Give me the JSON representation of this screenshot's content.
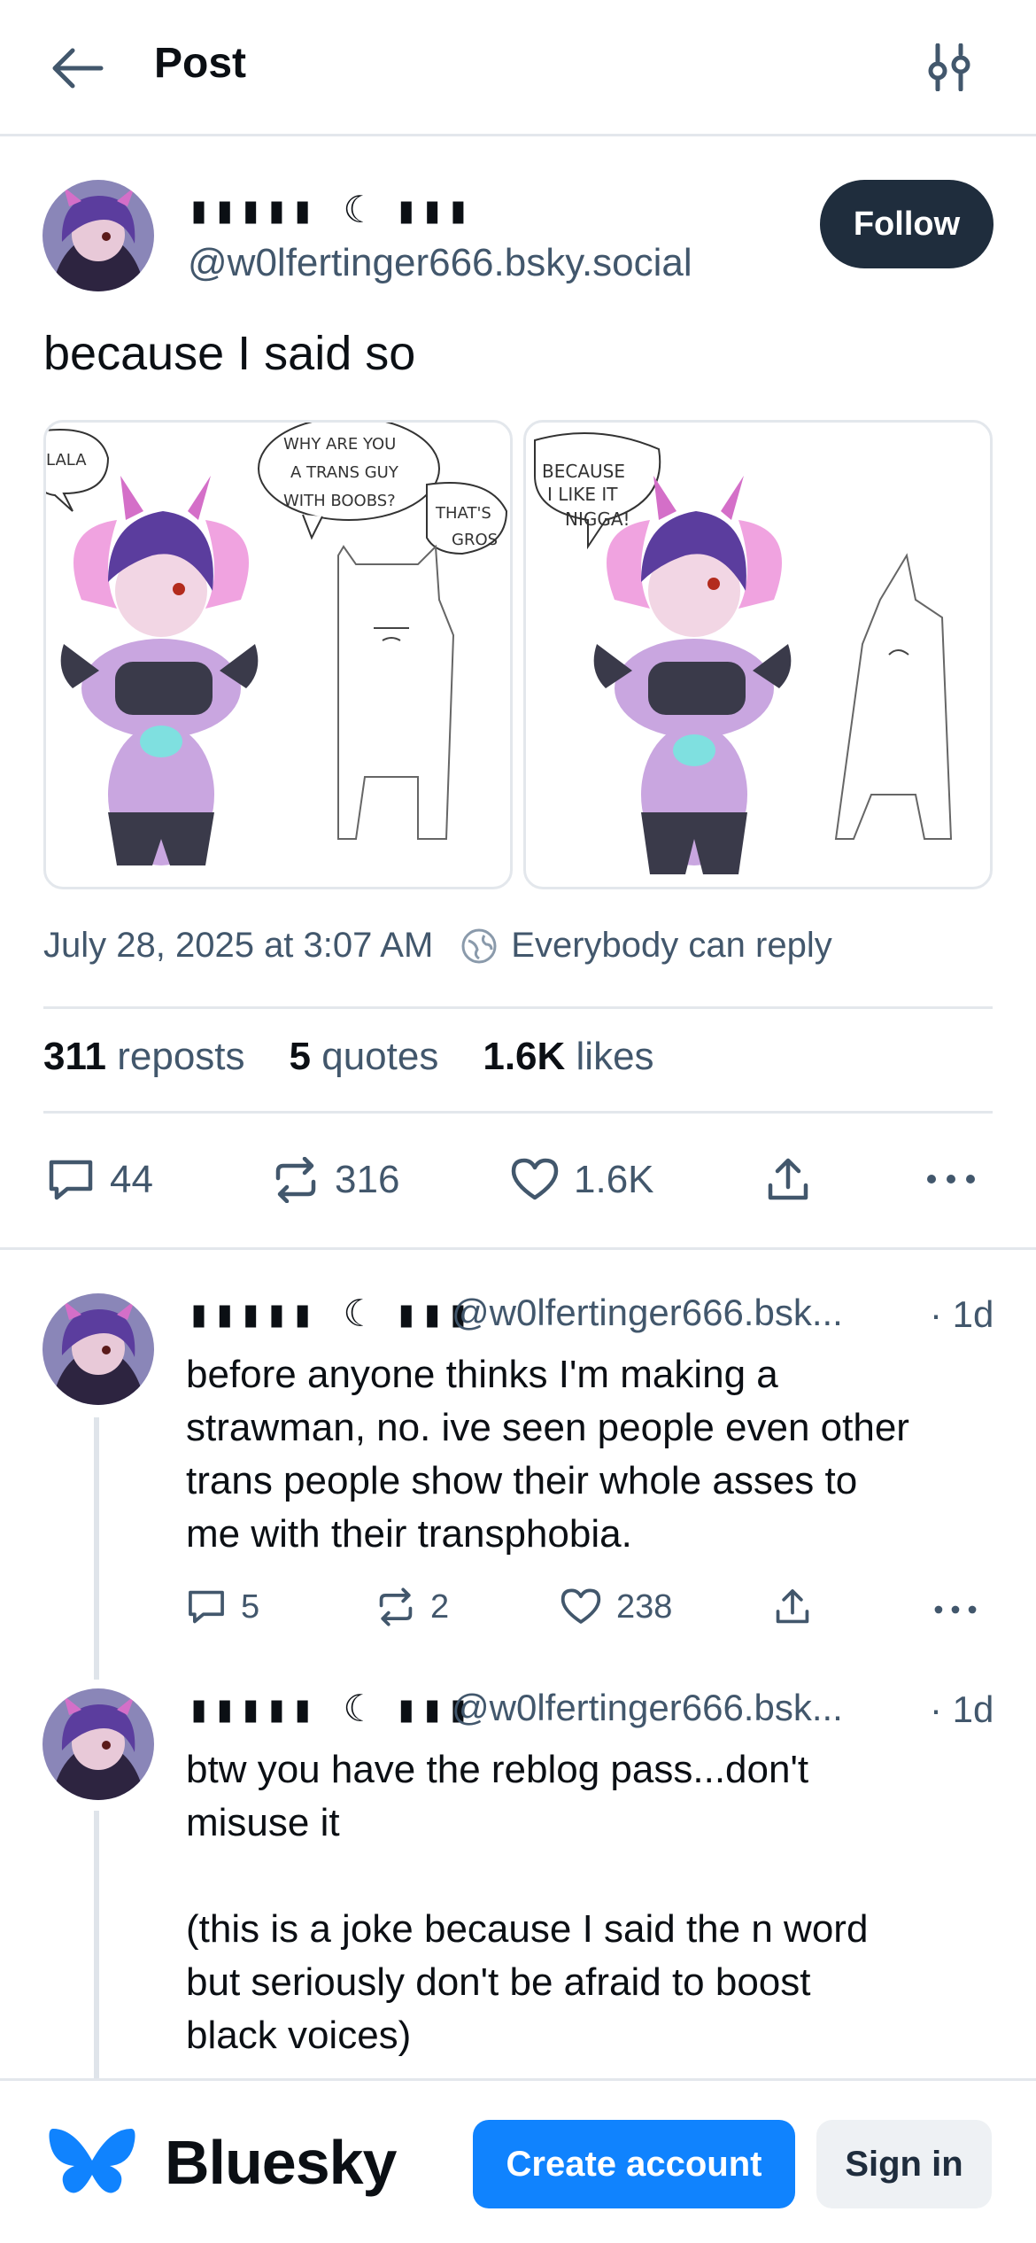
{
  "header": {
    "title": "Post",
    "back_icon": "arrow-left-icon",
    "filter_icon": "sliders-icon"
  },
  "post": {
    "author_name": "▮▮▮▮▮ ☾ ▮▮▮",
    "author_handle": "@w0lfertinger666.bsky.social",
    "follow_label": "Follow",
    "text": "because I said so",
    "images": [
      {
        "bubbles": [
          "LALA",
          "WHY ARE YOU",
          "A TRANS GUY",
          "WITH BOOBS?",
          "THAT'S",
          "GROS"
        ]
      },
      {
        "bubbles": [
          "BECAUSE",
          "I LIKE IT",
          "NIGGA!"
        ]
      }
    ],
    "timestamp": "July 28, 2025 at 3:07 AM",
    "reply_setting": "Everybody can reply",
    "stats": {
      "reposts_count": "311",
      "reposts_label": "reposts",
      "quotes_count": "5",
      "quotes_label": "quotes",
      "likes_count": "1.6K",
      "likes_label": "likes"
    },
    "actions": {
      "replies": "44",
      "reposts": "316",
      "likes": "1.6K"
    }
  },
  "replies": [
    {
      "author_name": "▮▮▮▮▮ ☾ ▮▮▮",
      "handle": "@w0lfertinger666.bsk...",
      "time": "· 1d",
      "text": "before anyone thinks I'm making a\nstrawman, no. ive seen people even other\ntrans people show their whole asses to\nme with their transphobia.",
      "replies": "5",
      "reposts": "2",
      "likes": "238"
    },
    {
      "author_name": "▮▮▮▮▮ ☾ ▮▮▮",
      "handle": "@w0lfertinger666.bsk...",
      "time": "· 1d",
      "text": "btw you have the reblog pass...don't\nmisuse it\n\n(this is a joke because I said the n word\nbut seriously don't be afraid to boost\nblack voices)"
    }
  ],
  "footer": {
    "brand": "Bluesky",
    "create_label": "Create account",
    "signin_label": "Sign in",
    "logo_icon": "butterfly-logo-icon"
  },
  "colors": {
    "accent": "#1083fe",
    "text": "#0b0f14",
    "muted": "#42576c",
    "border": "#e3e7ec",
    "follow_bg": "#1f2d3d"
  }
}
